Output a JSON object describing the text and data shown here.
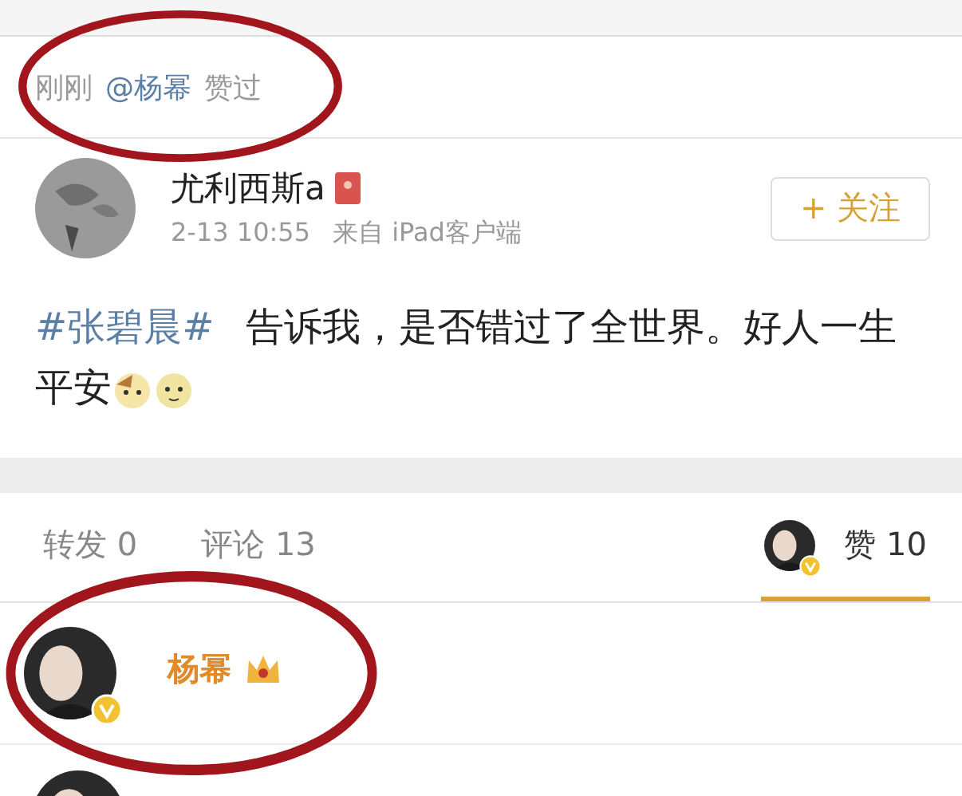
{
  "activity": {
    "time": "刚刚",
    "user": "@杨幂",
    "action": "赞过",
    "circled": true
  },
  "post": {
    "author": "尤利西斯a",
    "time": "2-13 10:55",
    "source": "来自 iPad客户端",
    "follow_button": "+ 关注",
    "hashtag": "#张碧晨#",
    "text": "告诉我，是否错过了全世界。好人一生平安"
  },
  "tabs": [
    {
      "label": "转发 0",
      "selected": false
    },
    {
      "label": "评论 13",
      "selected": false
    },
    {
      "label": "赞 10",
      "selected": true
    }
  ],
  "likers": [
    {
      "kind": "full",
      "name": "杨幂",
      "verified": true,
      "circled": true
    },
    {
      "kind": "avatar-only"
    }
  ]
}
